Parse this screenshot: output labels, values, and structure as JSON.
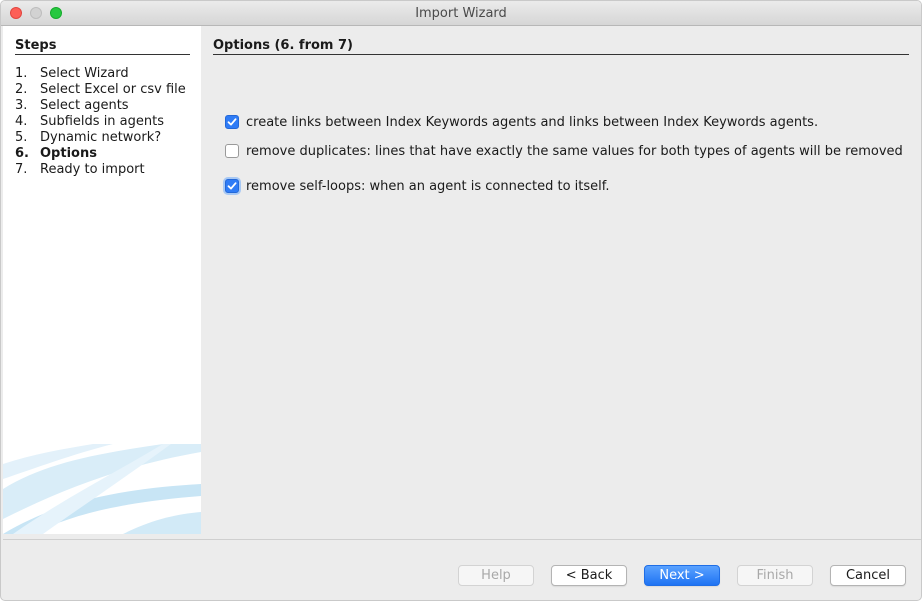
{
  "window": {
    "title": "Import Wizard"
  },
  "sidebar": {
    "heading": "Steps",
    "steps": [
      {
        "num": "1.",
        "label": "Select Wizard",
        "active": false
      },
      {
        "num": "2.",
        "label": "Select Excel or csv file",
        "active": false
      },
      {
        "num": "3.",
        "label": "Select agents",
        "active": false
      },
      {
        "num": "4.",
        "label": "Subfields in agents",
        "active": false
      },
      {
        "num": "5.",
        "label": "Dynamic network?",
        "active": false
      },
      {
        "num": "6.",
        "label": "Options",
        "active": true
      },
      {
        "num": "7.",
        "label": "Ready to import",
        "active": false
      }
    ]
  },
  "main": {
    "heading": "Options (6. from 7)",
    "options": [
      {
        "label": "create links between Index Keywords agents and links between Index Keywords agents.",
        "checked": true
      },
      {
        "label": "remove duplicates: lines that have exactly the same values for both types of agents will be removed",
        "checked": false
      },
      {
        "label": "remove self-loops: when an agent is connected to itself.",
        "checked": true,
        "focused": true
      }
    ]
  },
  "buttons": {
    "help": "Help",
    "back": "< Back",
    "next": "Next >",
    "finish": "Finish",
    "cancel": "Cancel"
  },
  "colors": {
    "accent": "#2f7cf6",
    "primary_button": "#1f73f3"
  }
}
